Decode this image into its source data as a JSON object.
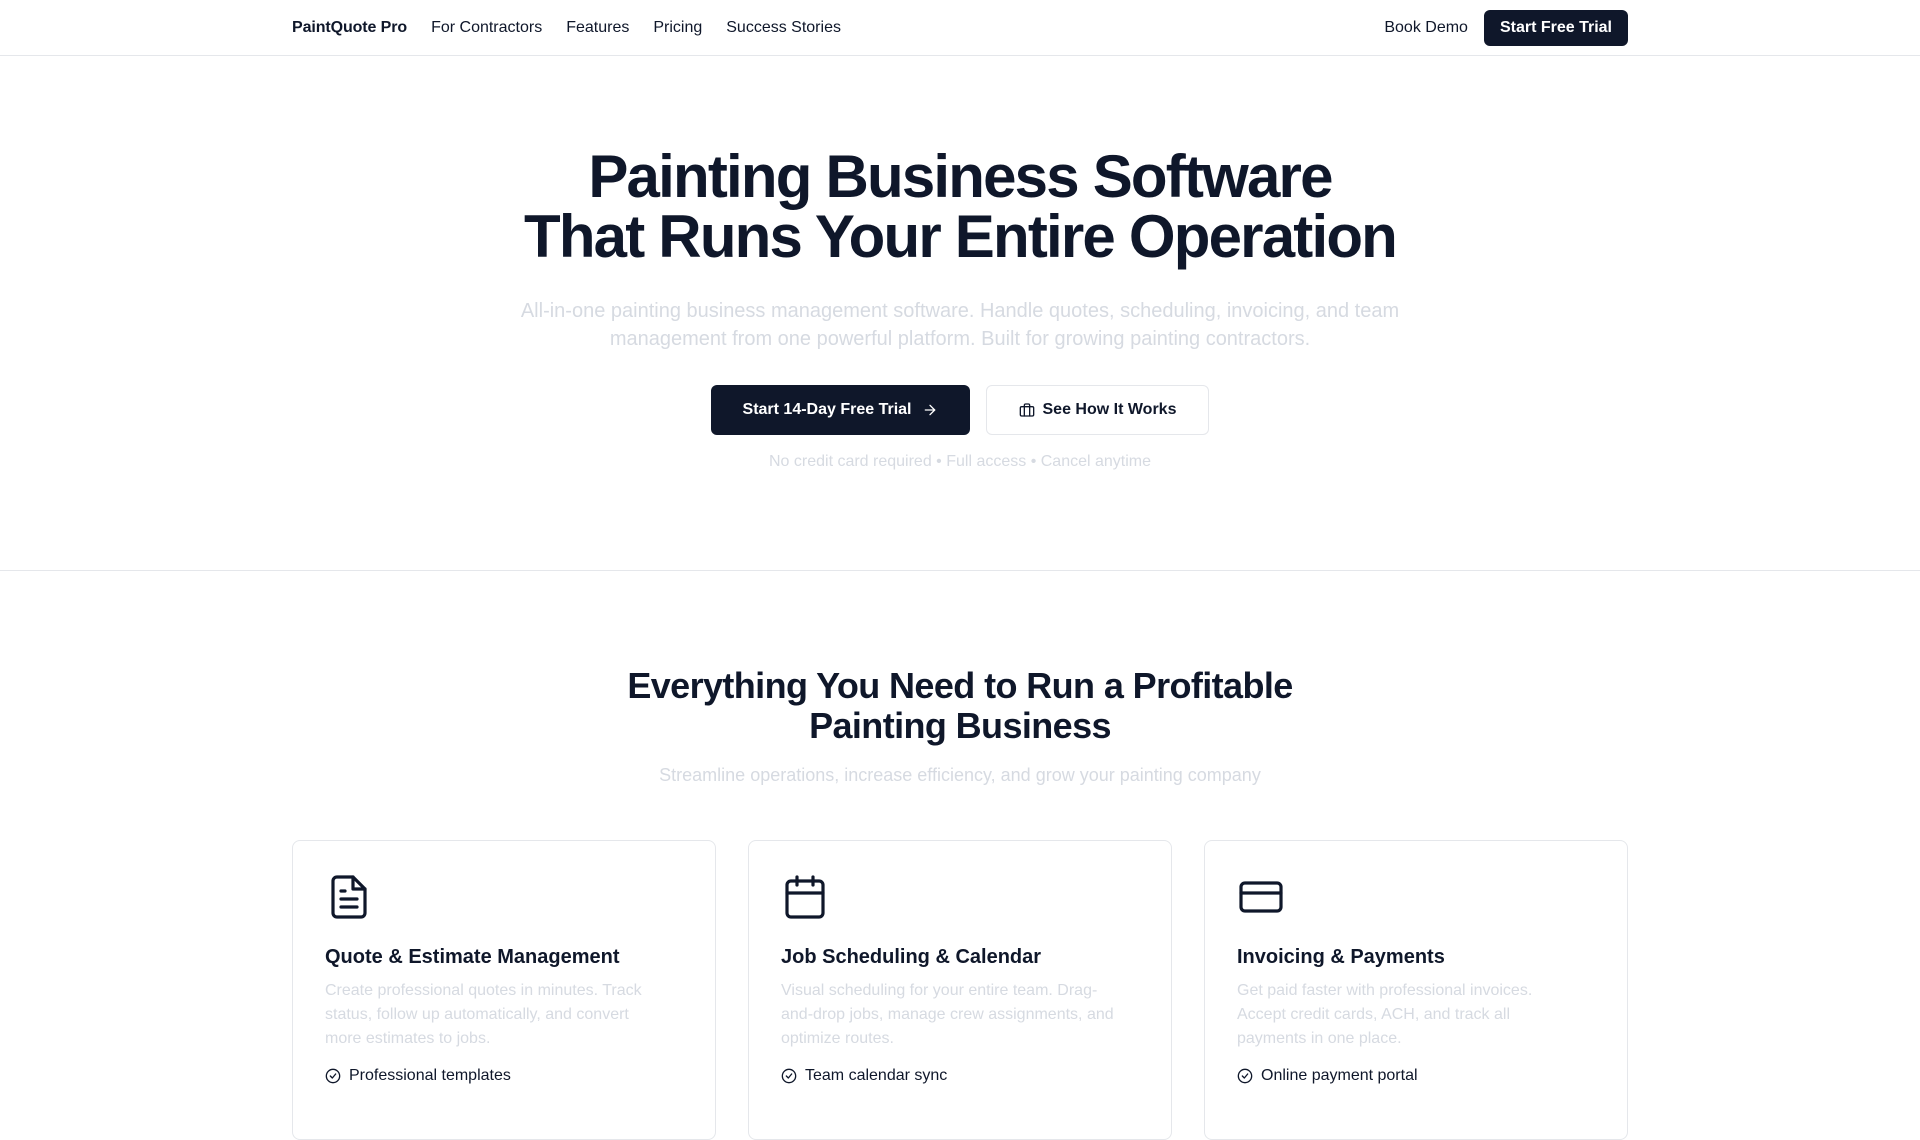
{
  "nav": {
    "brand": "PaintQuote Pro",
    "links": [
      "For Contractors",
      "Features",
      "Pricing",
      "Success Stories"
    ],
    "book_demo": "Book Demo",
    "start_trial": "Start Free Trial"
  },
  "hero": {
    "title_line1": "Painting Business Software",
    "title_line2": "That Runs Your Entire Operation",
    "subtitle": "All-in-one painting business management software. Handle quotes, scheduling, invoicing, and team management from one powerful platform. Built for growing painting contractors.",
    "primary_cta": "Start 14-Day Free Trial",
    "secondary_cta": "See How It Works",
    "note": "No credit card required • Full access • Cancel anytime"
  },
  "features": {
    "title_line1": "Everything You Need to Run a Profitable",
    "title_line2": "Painting Business",
    "subtitle": "Streamline operations, increase efficiency, and grow your painting company",
    "cards": [
      {
        "icon": "document-icon",
        "title": "Quote & Estimate Management",
        "description": "Create professional quotes in minutes. Track status, follow up automatically, and convert more estimates to jobs.",
        "bullet": "Professional templates"
      },
      {
        "icon": "calendar-icon",
        "title": "Job Scheduling & Calendar",
        "description": "Visual scheduling for your entire team. Drag-and-drop jobs, manage crew assignments, and optimize routes.",
        "bullet": "Team calendar sync"
      },
      {
        "icon": "credit-card-icon",
        "title": "Invoicing & Payments",
        "description": "Get paid faster with professional invoices. Accept credit cards, ACH, and track all payments in one place.",
        "bullet": "Online payment portal"
      }
    ]
  },
  "colors": {
    "primary": "#0f172a",
    "muted_text": "#d6dae1",
    "border": "#e5e7eb"
  }
}
